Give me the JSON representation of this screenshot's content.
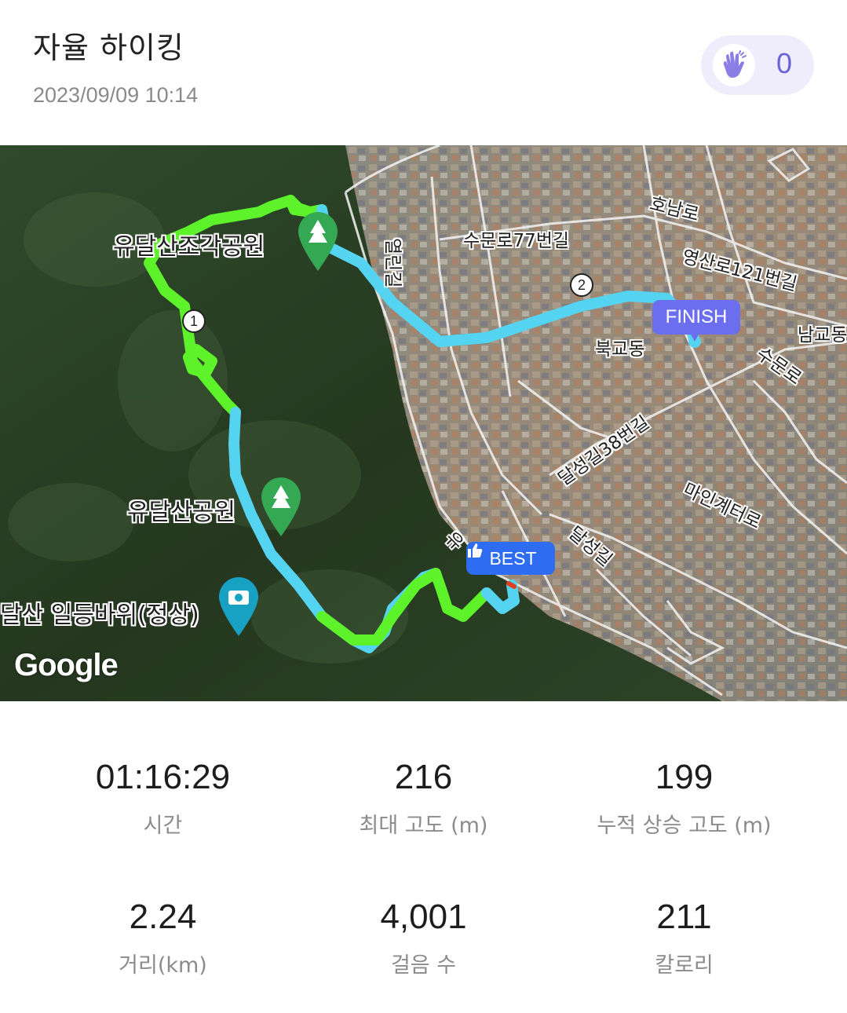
{
  "header": {
    "title": "자율 하이킹",
    "date": "2023/09/09 10:14",
    "clap_count": "0"
  },
  "map": {
    "labels": {
      "park_sculpture": "유달산조각공원",
      "park": "유달산공원",
      "peak": "달산 일등바위(정상)",
      "road_yeolli": "열린길",
      "road_sumun77": "수문로77번길",
      "road_honam": "호남로",
      "road_yeongsan121": "영산로121번길",
      "dong_bukgyo": "북교동",
      "dong_namgyo": "남교동",
      "road_sumun": "수문로",
      "road_dalseong38": "달성길38번길",
      "road_mainkyeter": "마인계터로",
      "road_dalseong": "달성길",
      "road_yu": "유",
      "google": "Google"
    },
    "markers": {
      "finish": "FINISH",
      "best": "BEST",
      "km1": "1",
      "km2": "2"
    },
    "colors": {
      "route_fast": "#55d4f2",
      "route_slow": "#5ef22a",
      "finish_bg": "#6c6ef0",
      "best_bg": "#2e6cf2",
      "poi_pin": "#34a853"
    }
  },
  "stats": [
    {
      "value": "01:16:29",
      "label": "시간"
    },
    {
      "value": "216",
      "label": "최대 고도 (m)"
    },
    {
      "value": "199",
      "label": "누적 상승 고도 (m)"
    },
    {
      "value": "2.24",
      "label": "거리(km)"
    },
    {
      "value": "4,001",
      "label": "걸음 수"
    },
    {
      "value": "211",
      "label": "칼로리"
    }
  ]
}
